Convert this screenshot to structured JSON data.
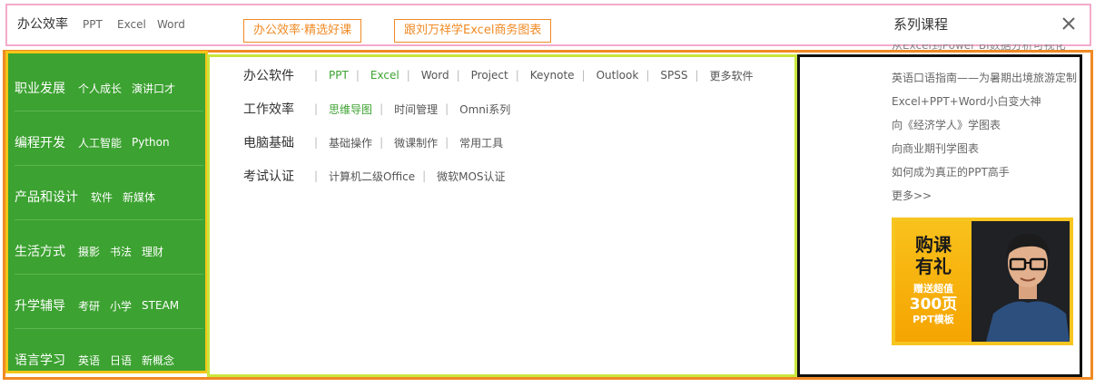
{
  "top": {
    "main_label": "办公效率",
    "items": [
      "PPT",
      "Excel",
      "Word"
    ],
    "tag_buttons": [
      "办公效率·精选好课",
      "跟刘万祥学Excel商务图表"
    ],
    "series_title": "系列课程"
  },
  "categories": [
    {
      "main": "职业发展",
      "subs": [
        "个人成长",
        "演讲口才"
      ]
    },
    {
      "main": "编程开发",
      "subs": [
        "人工智能",
        "Python"
      ]
    },
    {
      "main": "产品和设计",
      "subs": [
        "软件",
        "新媒体"
      ]
    },
    {
      "main": "生活方式",
      "subs": [
        "摄影",
        "书法",
        "理财"
      ]
    },
    {
      "main": "升学辅导",
      "subs": [
        "考研",
        "小学",
        "STEAM"
      ]
    },
    {
      "main": "语言学习",
      "subs": [
        "英语",
        "日语",
        "新概念"
      ]
    }
  ],
  "link_rows": [
    {
      "label": "办公软件",
      "links": [
        "PPT",
        "Excel",
        "Word",
        "Project",
        "Keynote",
        "Outlook",
        "SPSS",
        "更多软件"
      ],
      "green": [
        0,
        1
      ]
    },
    {
      "label": "工作效率",
      "links": [
        "思维导图",
        "时间管理",
        "Omni系列"
      ],
      "green": [
        0
      ]
    },
    {
      "label": "电脑基础",
      "links": [
        "基础操作",
        "微课制作",
        "常用工具"
      ],
      "green": []
    },
    {
      "label": "考试认证",
      "links": [
        "计算机二级Office",
        "微软MOS认证"
      ],
      "green": []
    }
  ],
  "series": {
    "cut_item": "从Excel到Power BI数据分析可视化",
    "items": [
      "英语口语指南——为暑期出境旅游定制",
      "Excel+PPT+Word小白变大神",
      "向《经济学人》学图表",
      "向商业期刊学图表",
      "如何成为真正的PPT高手",
      "更多>>"
    ]
  },
  "promo": {
    "line1": "购课",
    "line2": "有礼",
    "line3": "赠送超值",
    "line4": "300页",
    "line5": "PPT模板"
  },
  "colors": {
    "green": "#3ca231",
    "orange": "#f08a24",
    "pink_border": "#f4aacb",
    "yellow_border": "#f5c518",
    "lime_border": "#c8e63c"
  }
}
